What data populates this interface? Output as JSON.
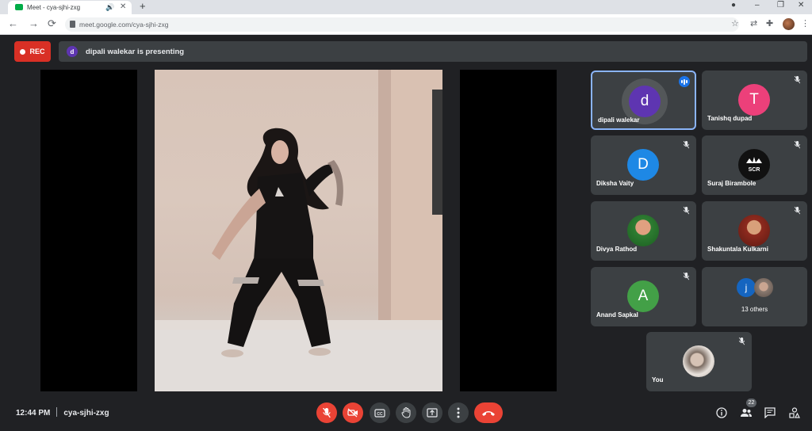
{
  "browser": {
    "tab_title": "Meet - cya-sjhi-zxg",
    "url": "meet.google.com/cya-sjhi-zxg"
  },
  "meeting": {
    "rec_label": "REC",
    "presenter_initial": "d",
    "presenting_text": "dipali walekar is presenting",
    "time": "12:44 PM",
    "code": "cya-sjhi-zxg",
    "people_count": "22"
  },
  "participants": [
    {
      "name": "dipali walekar",
      "initial": "d",
      "color": "#5e35b1",
      "speaking": true
    },
    {
      "name": "Tanishq dupad",
      "initial": "T",
      "color": "#ec407a"
    },
    {
      "name": "Diksha Vaity",
      "initial": "D",
      "color": "#1e88e5"
    },
    {
      "name": "Suraj Birambole",
      "initial": "",
      "color": "#111111"
    },
    {
      "name": "Divya Rathod",
      "initial": "",
      "color": "#2e7d32"
    },
    {
      "name": "Shakuntala Kulkarni",
      "initial": "",
      "color": "#b71c1c"
    },
    {
      "name": "Anand Sapkal",
      "initial": "A",
      "color": "#43a047"
    },
    {
      "name": "13 others",
      "initial": "j",
      "color": "#1565c0"
    },
    {
      "name": "You",
      "initial": "",
      "color": "#cccccc"
    }
  ],
  "colors": {
    "background": "#202124",
    "tile": "#3c4043",
    "danger": "#ea4335",
    "active_border": "#8ab4f8"
  }
}
